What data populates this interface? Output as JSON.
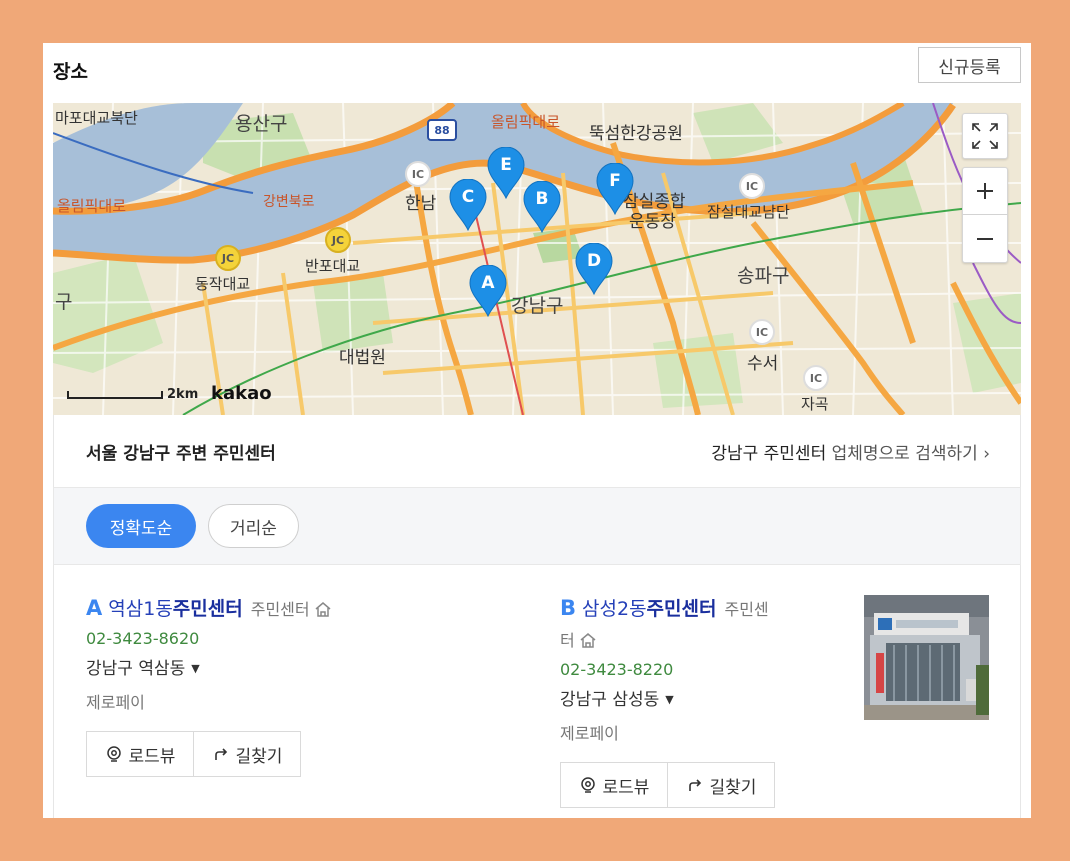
{
  "header": {
    "title": "장소",
    "new_button": "신규등록"
  },
  "map": {
    "scale_label": "2km",
    "provider": "kakao",
    "labels": [
      "마포대교북단",
      "용산구",
      "올림픽대로",
      "뚝섬한강공원",
      "잠실종합",
      "운동장",
      "잠실대교남단",
      "올림픽대로",
      "강변북로",
      "한남",
      "동작대교",
      "반포대교",
      "송파구",
      "강남구",
      "대법원",
      "수서",
      "자곡",
      "구"
    ],
    "markers": [
      "A",
      "B",
      "C",
      "D",
      "E",
      "F"
    ],
    "road_badges": [
      "88",
      "IC",
      "JC"
    ]
  },
  "result_header": {
    "title": "서울 강남구 주변 주민센터",
    "search_keyword": "강남구 주민센터",
    "search_suffix": " 업체명으로 검색하기 ›"
  },
  "sort": {
    "accuracy": "정확도순",
    "distance": "거리순"
  },
  "results": [
    {
      "letter": "A",
      "name_prefix": "역삼1동",
      "name_bold": "주민센터",
      "category": "주민센터",
      "phone": "02-3423-8620",
      "address": "강남구 역삼동",
      "payment": "제로페이",
      "roadview": "로드뷰",
      "directions": "길찾기"
    },
    {
      "letter": "B",
      "name_prefix": "삼성2동",
      "name_bold": "주민센터",
      "category_line1": "주민센",
      "category_line2": "터",
      "phone": "02-3423-8220",
      "address": "강남구 삼성동",
      "payment": "제로페이",
      "roadview": "로드뷰",
      "directions": "길찾기"
    }
  ],
  "colors": {
    "frame": "#f0a878",
    "accent": "#3b86f0",
    "marker": "#1d8fe6",
    "phone": "#3f8a3f"
  }
}
